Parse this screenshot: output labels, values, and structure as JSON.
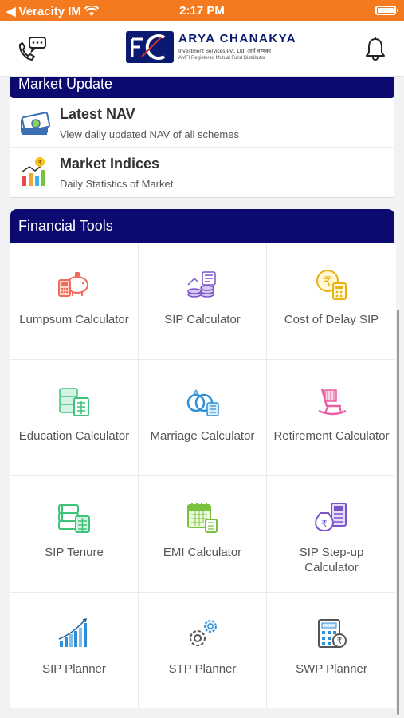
{
  "status_bar": {
    "carrier": "Veracity IM",
    "time": "2:17 PM"
  },
  "header": {
    "logo_title": "ARYA CHANAKYA",
    "logo_sub": "Investment Services Pvt. Ltd. आर्य चाणक्य",
    "logo_sub2": "AMFI Registered Mutual Fund Distributor"
  },
  "market_update": {
    "title": "Market Update",
    "items": [
      {
        "title": "Latest NAV",
        "desc": "View daily updated NAV of all schemes",
        "icon": "money-stack-icon"
      },
      {
        "title": "Market Indices",
        "desc": "Daily Statistics of Market",
        "icon": "bar-chart-rupee-icon"
      }
    ]
  },
  "financial_tools": {
    "title": "Financial Tools",
    "tiles": [
      {
        "label": "Lumpsum Calculator",
        "icon": "piggy-bank-calculator-icon",
        "color": "#f26b5b"
      },
      {
        "label": "SIP Calculator",
        "icon": "coin-stack-icon",
        "color": "#7a56c9"
      },
      {
        "label": "Cost of Delay SIP",
        "icon": "rupee-calculator-icon",
        "color": "#e8b30f"
      },
      {
        "label": "Education Calculator",
        "icon": "book-calculator-icon",
        "color": "#3ec27a"
      },
      {
        "label": "Marriage Calculator",
        "icon": "rings-calculator-icon",
        "color": "#2f8fd6"
      },
      {
        "label": "Retirement Calculator",
        "icon": "rocking-chair-icon",
        "color": "#e85fa6"
      },
      {
        "label": "SIP Tenure",
        "icon": "stacked-books-calculator-icon",
        "color": "#3ec27a"
      },
      {
        "label": "EMI Calculator",
        "icon": "calendar-calculator-icon",
        "color": "#7ac23e"
      },
      {
        "label": "SIP Step-up Calculator",
        "icon": "rupee-bag-calculator-icon",
        "color": "#7a56c9"
      },
      {
        "label": "SIP Planner",
        "icon": "growth-bars-icon",
        "color": "#2f8fd6"
      },
      {
        "label": "STP Planner",
        "icon": "gears-icon",
        "color": "#2f8fd6"
      },
      {
        "label": "SWP Planner",
        "icon": "calculator-rupee-icon",
        "color": "#2f8fd6"
      }
    ]
  },
  "colors": {
    "status_bar": "#f47a20",
    "brand_navy": "#0a0a70"
  }
}
